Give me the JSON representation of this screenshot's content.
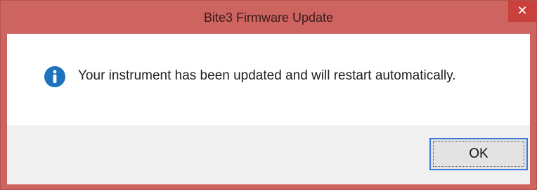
{
  "window": {
    "title": "Bite3 Firmware Update",
    "close_glyph": "✕"
  },
  "message": {
    "icon": "info-icon",
    "text": "Your instrument has been updated and will restart automatically."
  },
  "buttons": {
    "ok_label": "OK"
  },
  "colors": {
    "titlebar": "#cd6460",
    "close_button": "#c9403c",
    "info_icon": "#1e73be",
    "button_focus": "#3c78d8"
  }
}
